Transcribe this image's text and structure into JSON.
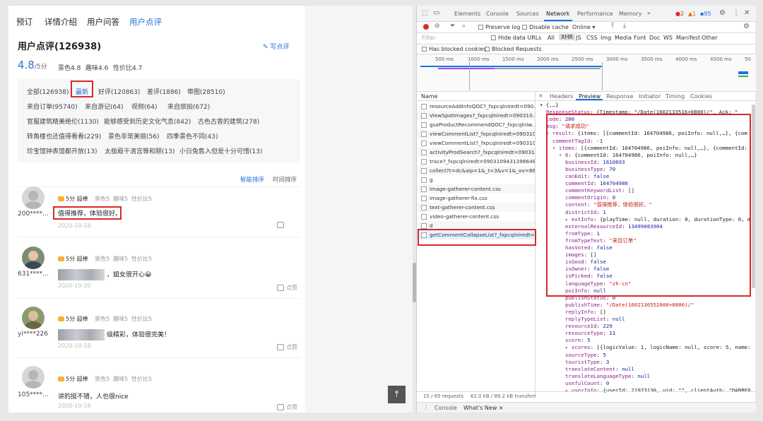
{
  "left": {
    "tabs": [
      "预订",
      "详情介绍",
      "用户问答",
      "用户点评"
    ],
    "title": "用户点评(126938)",
    "write_label": "写点评",
    "score": "4.8",
    "score_suffix": "/5分",
    "sub_scores": [
      "景色4.8",
      "趣味4.6",
      "性价比4.7"
    ],
    "tag_rows": [
      [
        "全部(126938)",
        "最新",
        "好评(120863)",
        "差评(1886)",
        "带图(28510)"
      ],
      [
        "来自订单(95740)",
        "来自游记(64)",
        "视频(64)",
        "来自旅拍(672)"
      ],
      [
        "官服建筑精美绝伦(1130)",
        "能够感受到历史文化气息(842)",
        "古色古香的建筑(278)"
      ],
      [
        "转角楼也还值得看看(229)",
        "景色非常美丽(56)",
        "四季景色不同(43)"
      ],
      [
        "珍宝馆钟表馆都开放(13)",
        "太极殿干清宫等和颐(13)",
        "小日兔售入但是十分可惜(13)"
      ]
    ],
    "sort_options": [
      "智能排序",
      "时间排序"
    ],
    "reviews": [
      {
        "user": "200****...",
        "rating": "5分 超棒",
        "scores": [
          "景色5",
          "趣味5",
          "性价比5"
        ],
        "content": "值得推荐，体验很好。",
        "date": "2020-10-18",
        "likes": "",
        "content_blurred": false
      },
      {
        "user": "631****...",
        "rating": "5分 超棒",
        "scores": [
          "景色5",
          "趣味5",
          "性价比5"
        ],
        "content": "，姐女很开心😀",
        "date": "2020-10-20",
        "likes": "点赞",
        "content_blurred": true
      },
      {
        "user": "yi****226",
        "rating": "5分 超棒",
        "scores": [
          "景色5",
          "趣味5",
          "性价比5"
        ],
        "content": "级精彩，体验很完美！",
        "date": "2020-10-18",
        "likes": "点赞",
        "content_blurred": true
      },
      {
        "user": "105****...",
        "rating": "5分 超棒",
        "scores": [
          "景色5",
          "趣味5",
          "性价比5"
        ],
        "content": "讲的挺不错，人也很nice",
        "date": "2020-10-18",
        "likes": "点赞",
        "content_blurred": false
      }
    ],
    "back_to_top": "⤒"
  },
  "devtools": {
    "tabs": [
      "Elements",
      "Console",
      "Sources",
      "Network",
      "Performance",
      "Memory",
      "»"
    ],
    "active_tab": "Network",
    "error_count": "2",
    "warn_count": "1",
    "issue_count": "95",
    "preserve_log": "Preserve log",
    "disable_cache": "Disable cache",
    "throttle": "Online",
    "filter_placeholder": "Filter",
    "hide_data_urls": "Hide data URLs",
    "filter_types": [
      "All",
      "XHR",
      "JS",
      "CSS",
      "Img",
      "Media",
      "Font",
      "Doc",
      "WS",
      "Manifest",
      "Other"
    ],
    "active_filter": "XHR",
    "has_blocked_cookies": "Has blocked cookies",
    "blocked_requests": "Blocked Requests",
    "timeline_ticks": [
      "500 ms",
      "1000 ms",
      "1500 ms",
      "2000 ms",
      "2500 ms",
      "3000 ms",
      "3500 ms",
      "4000 ms",
      "4500 ms",
      "50"
    ],
    "name_header": "Name",
    "requests": [
      "resourceAddInfoQOC?_fxpcqlniredt=090...",
      "ViewSpotImages?_fxpcqlniredt=090310...",
      "gsaProductRecommendQOC?_fxpcqlniw...",
      "viewCommentList?_fxpcqlniredt=090310...",
      "viewCommentList?_fxpcqlniredt=090310...",
      "activityProdSearch?_fxpcqlniredt=09031...",
      "trace?_fxpcqlniredt=09031094313986481...",
      "collect?t=dc&aip=1&_t=3&v=1&_ov=86&...",
      "g",
      "image-gatherer-content.css",
      "image-gatherer-fix.css",
      "text-gatherer-content.css",
      "video-gatherer-content.css",
      "d",
      "getCommentCollapseList?_fxpcqlniredt=..."
    ],
    "status_bar": "15 / 65 requests",
    "transfer": "62.0 kB / 89.2 kB transferr",
    "detail_tabs": [
      "×",
      "Headers",
      "Preview",
      "Response",
      "Initiator",
      "Timing",
      "Cookies"
    ],
    "active_detail_tab": "Preview",
    "drawer_tabs": [
      "Console",
      "What's New ×"
    ],
    "json_lines": [
      {
        "i": 0,
        "t": "▾ {,…}",
        "c": "g"
      },
      {
        "i": 1,
        "t": "ResponseStatus: {Timestamp: \"/Date(1602133516+0800)/\", Ack: \"",
        "c": "k"
      },
      {
        "i": 1,
        "t": "code: 200",
        "c": "k"
      },
      {
        "i": 1,
        "t": "msg: \"请求成功\"",
        "c": "k"
      },
      {
        "i": 1,
        "t": "▾ result: {items: [{commentId: 164704986, poiInfo: null,…}, {com",
        "c": "k"
      },
      {
        "i": 2,
        "t": "commentTagId: -1",
        "c": "k"
      },
      {
        "i": 2,
        "t": "▾ items: [{commentId: 164704986, poiInfo: null,…}, {commentId: 1",
        "c": "k"
      },
      {
        "i": 3,
        "t": "▾ 0: {commentId: 164704986, poiInfo: null,…}",
        "c": "k"
      },
      {
        "i": 4,
        "t": "businessId: 1610693",
        "c": "k"
      },
      {
        "i": 4,
        "t": "businessType: 70",
        "c": "k"
      },
      {
        "i": 4,
        "t": "canEdit: false",
        "c": "k"
      },
      {
        "i": 4,
        "t": "commentId: 164704986",
        "c": "k"
      },
      {
        "i": 4,
        "t": "commentKeywordList: []",
        "c": "k"
      },
      {
        "i": 4,
        "t": "commentOrigin: 0",
        "c": "k"
      },
      {
        "i": 4,
        "t": "content: \"值得推荐，体验很好。\"",
        "c": "k"
      },
      {
        "i": 4,
        "t": "districtId: 1",
        "c": "k"
      },
      {
        "i": 4,
        "t": "▸ extInfo: {playTime: null, duration: 0, durationType: 0, m",
        "c": "k"
      },
      {
        "i": 4,
        "t": "externalResourceId: 13499083904",
        "c": "k"
      },
      {
        "i": 4,
        "t": "fromType: 1",
        "c": "k"
      },
      {
        "i": 4,
        "t": "fromTypeText: \"来自订单\"",
        "c": "k"
      },
      {
        "i": 4,
        "t": "hasVoted: false",
        "c": "k"
      },
      {
        "i": 4,
        "t": "images: []",
        "c": "k"
      },
      {
        "i": 4,
        "t": "isGood: false",
        "c": "k"
      },
      {
        "i": 4,
        "t": "isOwner: false",
        "c": "k"
      },
      {
        "i": 4,
        "t": "isPicked: false",
        "c": "k"
      },
      {
        "i": 4,
        "t": "languageType: \"zh-cn\"",
        "c": "k"
      },
      {
        "i": 4,
        "t": "poiInfo: null",
        "c": "k"
      },
      {
        "i": 4,
        "t": "publishStatus: 0",
        "c": "k"
      },
      {
        "i": 4,
        "t": "publishTime: \"/Date(1602136552000+0800)/\"",
        "c": "k"
      },
      {
        "i": 4,
        "t": "replyInfo: []",
        "c": "k"
      },
      {
        "i": 4,
        "t": "replyTypeList: null",
        "c": "k"
      },
      {
        "i": 4,
        "t": "resourceId: 229",
        "c": "k"
      },
      {
        "i": 4,
        "t": "resourceType: 11",
        "c": "k"
      },
      {
        "i": 4,
        "t": "score: 5",
        "c": "k"
      },
      {
        "i": 4,
        "t": "▸ scores: [{logicValue: 1, logicName: null, score: 5, name:",
        "c": "k"
      },
      {
        "i": 4,
        "t": "sourceType: 5",
        "c": "k"
      },
      {
        "i": 4,
        "t": "touristType: 3",
        "c": "k"
      },
      {
        "i": 4,
        "t": "translateContent: null",
        "c": "k"
      },
      {
        "i": 4,
        "t": "translateLanguageType: null",
        "c": "k"
      },
      {
        "i": 4,
        "t": "usefulCount: 0",
        "c": "k"
      },
      {
        "i": 4,
        "t": "▸ userInfo: {userId: 21973130, uid: \"\", clientAuth: \"DABBF01",
        "c": "k"
      }
    ]
  }
}
